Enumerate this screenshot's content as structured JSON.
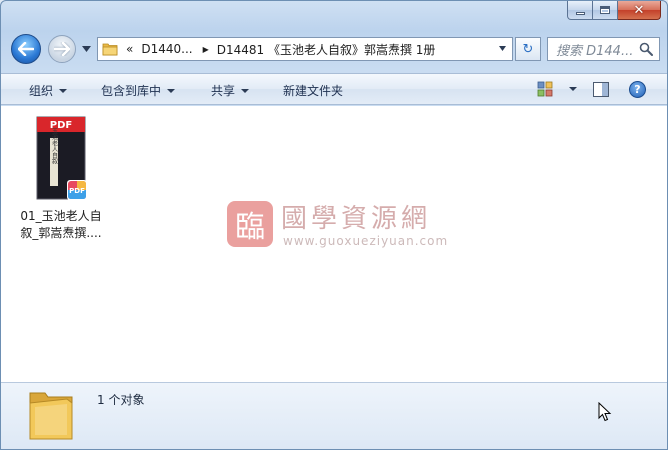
{
  "window": {
    "caption_buttons": [
      "minimize",
      "maximize",
      "close"
    ],
    "close_glyph": "✕"
  },
  "nav": {
    "back_glyph": "🡐",
    "forward_glyph": "🡒",
    "address": {
      "overflow": "«",
      "crumbs": [
        "D1440...",
        "D14481 《玉池老人自叙》郭嵩焘撰 1册"
      ]
    },
    "refresh_glyph": "↻",
    "search_placeholder": "搜索 D144..."
  },
  "commandbar": {
    "organize": "组织",
    "include_in_library": "包含到库中",
    "share": "共享",
    "new_folder": "新建文件夹",
    "help": "?"
  },
  "files": [
    {
      "name": "01_玉池老人自叙_郭嵩焘撰....",
      "thumb_badge": "PDF",
      "type_badge": "PDF",
      "cover_text": "玉池老人自叙"
    }
  ],
  "watermark": {
    "seal": "臨",
    "title": "國學資源網",
    "url": "www.guoxueziyuan.com"
  },
  "details": {
    "count_text": "1 个对象"
  },
  "colors": {
    "accent": "#2a78d4",
    "pdf_red": "#d9262b",
    "folder_yellow": "#f2c85a"
  }
}
